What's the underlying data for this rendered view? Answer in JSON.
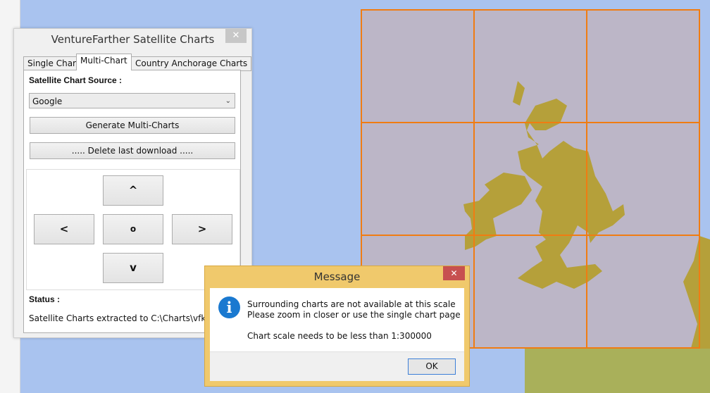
{
  "window": {
    "title": "VentureFarther Satellite Charts",
    "close_icon": "close-icon",
    "tabs": [
      {
        "label": "Single Chart"
      },
      {
        "label": "Multi-Chart",
        "active": true
      },
      {
        "label": "Country Anchorage Charts"
      }
    ],
    "source_label": "Satellite Chart Source :",
    "source_value": "Google",
    "generate_label": "Generate Multi-Charts",
    "delete_label": "..... Delete last download .....",
    "nav": {
      "up": "^",
      "left": "<",
      "center": "o",
      "right": ">",
      "down": "v"
    },
    "status_label": "Status :",
    "status_text": "Satellite Charts extracted to C:\\Charts\\vfkaps\\te"
  },
  "dialog": {
    "title": "Message",
    "icon": "info-icon",
    "lines": [
      "Surrounding charts are not available at this scale",
      "Please zoom in closer or use the single chart page",
      "Chart scale needs to be less than 1:300000"
    ],
    "ok_label": "OK"
  },
  "colors": {
    "sea": "#a9c3ef",
    "land": "#b5a03a",
    "grid": "#f07c12",
    "grid_fill": "#bcb6c7",
    "dialog_frame": "#f0c96c"
  }
}
